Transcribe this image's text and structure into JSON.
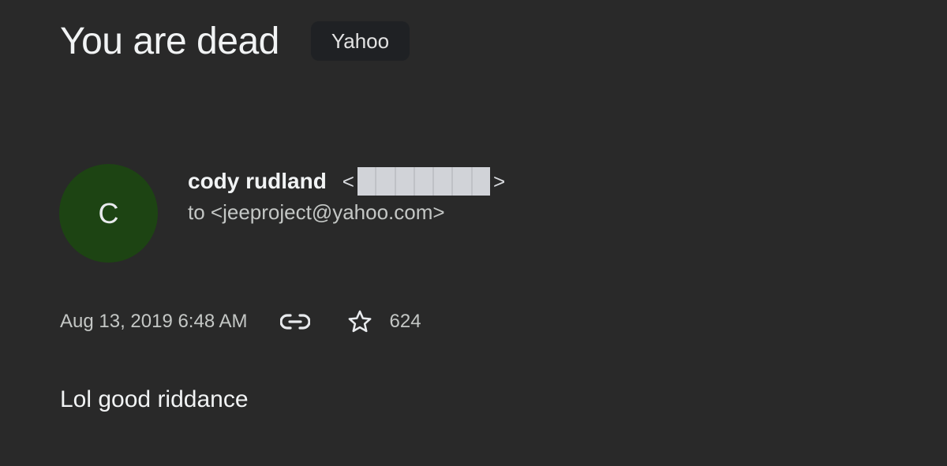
{
  "email": {
    "subject": "You are dead",
    "label": "Yahoo",
    "sender": {
      "avatar_initial": "C",
      "avatar_color": "#1d4413",
      "name": "cody rudland",
      "email_open_bracket": "<",
      "email_close_bracket": ">",
      "email_redacted": true
    },
    "to_line": "to <jeeproject@yahoo.com>",
    "date": "Aug 13, 2019 6:48 AM",
    "actions": {
      "link_icon": "link-icon",
      "star_icon": "star-icon",
      "count": "624"
    },
    "body": "Lol good riddance"
  },
  "theme": {
    "background": "#292929",
    "chip_background": "#1f2124",
    "text_primary": "#f1f3f4",
    "text_secondary": "#c4c7c5"
  }
}
